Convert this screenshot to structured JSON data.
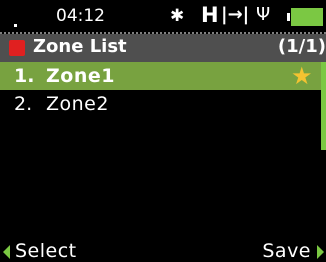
{
  "status_bar": {
    "time": "04:12",
    "bluetooth_icon": "bluetooth-icon",
    "h_indicator": "H",
    "io_glyph": "|→|",
    "usb_icon": "usb-icon",
    "battery_icon": "battery-icon",
    "battery_color": "#7bc843"
  },
  "title_bar": {
    "title": "Zone List",
    "page_indicator": "(1/1)",
    "icon_color": "#e02020"
  },
  "list": {
    "items": [
      {
        "number": "1.",
        "name": "Zone1",
        "selected": true,
        "favorite_icon": "star-icon"
      },
      {
        "number": "2.",
        "name": "Zone2",
        "selected": false
      }
    ]
  },
  "softkeys": {
    "left_label": "Select",
    "right_label": "Save"
  },
  "colors": {
    "selection": "#78a240",
    "accent": "#7bc843",
    "star": "#f3c331",
    "title_background": "#4f4f4f"
  }
}
